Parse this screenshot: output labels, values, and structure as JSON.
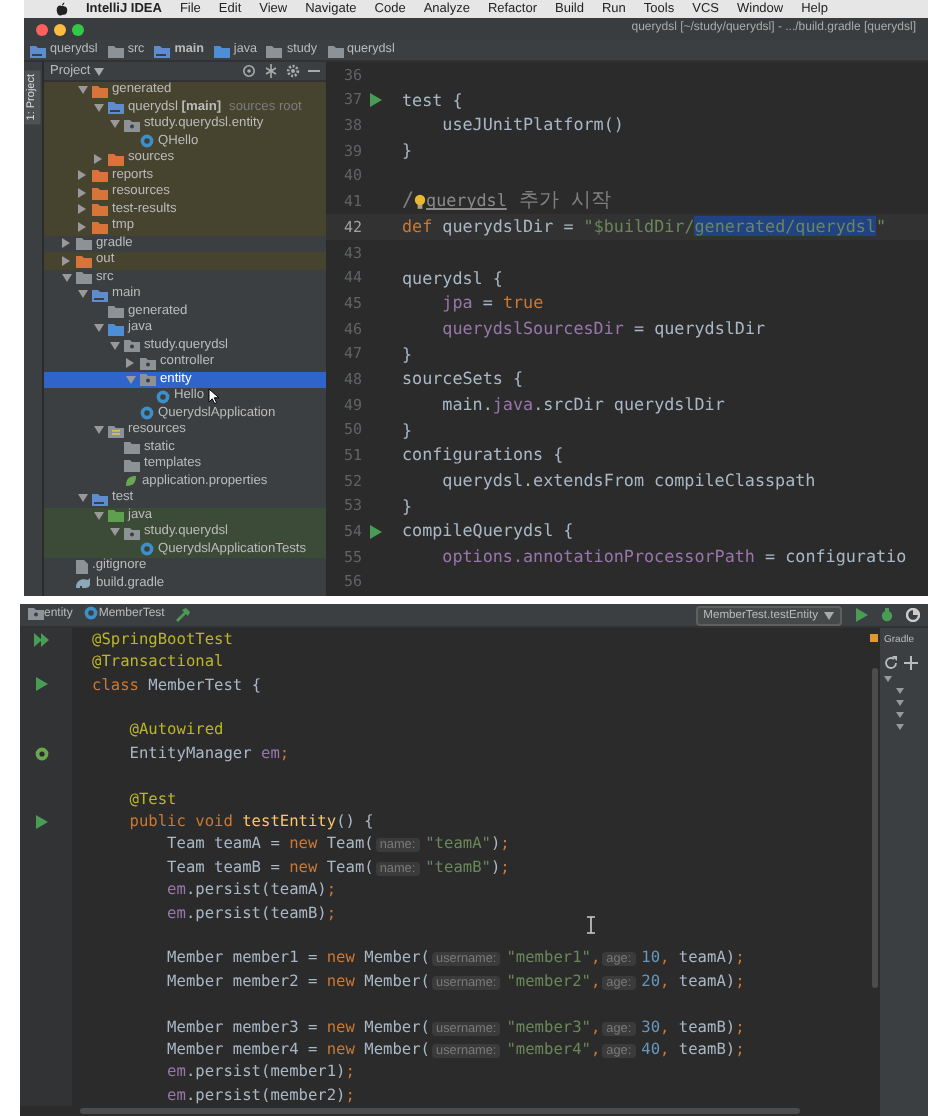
{
  "menubar": {
    "app": "IntelliJ IDEA",
    "items": [
      "File",
      "Edit",
      "View",
      "Navigate",
      "Code",
      "Analyze",
      "Refactor",
      "Build",
      "Run",
      "Tools",
      "VCS",
      "Window",
      "Help"
    ]
  },
  "window": {
    "title": "querydsl [~/study/querydsl] - .../build.gradle [querydsl]"
  },
  "breadcrumb": [
    {
      "label": "querydsl",
      "kind": "module",
      "bold": false
    },
    {
      "label": "src",
      "kind": "folder",
      "bold": false
    },
    {
      "label": "main",
      "kind": "module",
      "bold": true
    },
    {
      "label": "java",
      "kind": "source",
      "bold": false
    },
    {
      "label": "study",
      "kind": "folder",
      "bold": false
    },
    {
      "label": "querydsl",
      "kind": "folder",
      "bold": false
    }
  ],
  "project_panel": {
    "tool_tab": "1: Project",
    "title": "Project",
    "tree": [
      {
        "children": [
          {
            "label": "generated",
            "kind": "excluded",
            "expanded": true,
            "selected": false,
            "color": "#46432f",
            "children": [
              {
                "label": "querydsl **[main]**",
                "hint": "sources root",
                "kind": "module",
                "expanded": true,
                "selected": false,
                "color": "#46432f",
                "children": [
                  {
                    "label": "study.querydsl.entity",
                    "kind": "package",
                    "expanded": true,
                    "selected": false,
                    "color": "#46432f",
                    "children": [
                      {
                        "label": "QHello",
                        "kind": "class",
                        "selected": false,
                        "color": "#46432f"
                      }
                    ]
                  }
                ]
              },
              {
                "label": "sources",
                "kind": "excluded",
                "expanded": false,
                "selected": false,
                "color": "#46432f"
              }
            ]
          },
          {
            "label": "reports",
            "kind": "excluded",
            "expanded": false,
            "selected": false,
            "color": "#46432f"
          },
          {
            "label": "resources",
            "kind": "excluded",
            "expanded": false,
            "selected": false,
            "color": "#46432f"
          },
          {
            "label": "test-results",
            "kind": "excluded",
            "expanded": false,
            "selected": false,
            "color": "#46432f"
          },
          {
            "label": "tmp",
            "kind": "excluded",
            "expanded": false,
            "selected": false,
            "color": "#46432f"
          }
        ]
      },
      {
        "label": "gradle",
        "kind": "folder",
        "expanded": false,
        "selected": false
      },
      {
        "label": "out",
        "kind": "excluded",
        "expanded": false,
        "selected": false,
        "color": "#46432f"
      },
      {
        "label": "src",
        "kind": "folder",
        "expanded": true,
        "selected": false,
        "children": [
          {
            "label": "main",
            "kind": "module",
            "expanded": true,
            "selected": false,
            "children": [
              {
                "label": "generated",
                "kind": "folder",
                "selected": false
              },
              {
                "label": "java",
                "kind": "source",
                "expanded": true,
                "selected": false,
                "children": [
                  {
                    "label": "study.querydsl",
                    "kind": "package",
                    "expanded": true,
                    "selected": false,
                    "children": [
                      {
                        "label": "controller",
                        "kind": "package",
                        "expanded": false,
                        "selected": false
                      },
                      {
                        "label": "entity",
                        "kind": "package",
                        "expanded": true,
                        "selected": true,
                        "children": [
                          {
                            "label": "Hello",
                            "kind": "class",
                            "selected": false
                          }
                        ]
                      },
                      {
                        "label": "QuerydslApplication",
                        "kind": "class",
                        "selected": false
                      }
                    ]
                  }
                ]
              },
              {
                "label": "resources",
                "kind": "resource",
                "expanded": true,
                "selected": false,
                "children": [
                  {
                    "label": "static",
                    "kind": "folder",
                    "selected": false
                  },
                  {
                    "label": "templates",
                    "kind": "folder",
                    "selected": false
                  },
                  {
                    "label": "application.properties",
                    "kind": "properties",
                    "selected": false
                  }
                ]
              }
            ]
          },
          {
            "label": "test",
            "kind": "module",
            "expanded": true,
            "selected": false,
            "children": [
              {
                "label": "java",
                "kind": "test",
                "expanded": true,
                "selected": false,
                "color": "#3c4a38",
                "children": [
                  {
                    "label": "study.querydsl",
                    "kind": "package",
                    "expanded": true,
                    "selected": false,
                    "color": "#3c4a38",
                    "children": [
                      {
                        "label": "QuerydslApplicationTests",
                        "kind": "class",
                        "selected": false,
                        "color": "#3c4a38"
                      }
                    ]
                  }
                ]
              }
            ]
          }
        ]
      },
      {
        "label": ".gitignore",
        "kind": "file",
        "selected": false
      },
      {
        "label": "build.gradle",
        "kind": "gradle",
        "selected": false
      }
    ]
  },
  "editor": {
    "lines": [
      {
        "num": "36"
      },
      {
        "num": "37",
        "kind": "run",
        "tokens": [
          {
            "kind": "pl",
            "text": "test {"
          }
        ]
      },
      {
        "num": "38",
        "tokens": [
          {
            "kind": "pl",
            "text": "    useJUnitPlatform()"
          }
        ]
      },
      {
        "num": "39",
        "tokens": [
          {
            "kind": "pl",
            "text": "}"
          }
        ]
      },
      {
        "num": "40"
      },
      {
        "num": "41",
        "tokens": [
          {
            "kind": "cmt",
            "text": "/"
          },
          {
            "kind": "bulb"
          },
          {
            "kind": "link",
            "text": "querydsl"
          },
          {
            "kind": "cmt",
            "text": " 추가 시작"
          }
        ]
      },
      {
        "num": "42",
        "current": true,
        "tokens": [
          {
            "kind": "kw",
            "text": "def"
          },
          {
            "kind": "pl",
            "text": " querydslDir = "
          },
          {
            "kind": "str",
            "text": "\"$buildDir/"
          },
          {
            "kind": "sel",
            "text": "generated/querydsl"
          },
          {
            "kind": "str",
            "text": "\""
          }
        ]
      },
      {
        "num": "43"
      },
      {
        "num": "44",
        "tokens": [
          {
            "kind": "pl",
            "text": "querydsl {"
          }
        ]
      },
      {
        "num": "45",
        "tokens": [
          {
            "kind": "fld",
            "text": "    jpa"
          },
          {
            "kind": "pl",
            "text": " = "
          },
          {
            "kind": "kw",
            "text": "true"
          }
        ]
      },
      {
        "num": "46",
        "tokens": [
          {
            "kind": "fld",
            "text": "    querydslSourcesDir"
          },
          {
            "kind": "pl",
            "text": " = querydslDir"
          }
        ]
      },
      {
        "num": "47",
        "tokens": [
          {
            "kind": "pl",
            "text": "}"
          }
        ]
      },
      {
        "num": "48",
        "tokens": [
          {
            "kind": "pl",
            "text": "sourceSets {"
          }
        ]
      },
      {
        "num": "49",
        "tokens": [
          {
            "kind": "pl",
            "text": "    main."
          },
          {
            "kind": "fld",
            "text": "java"
          },
          {
            "kind": "pl",
            "text": ".srcDir querydslDir"
          }
        ]
      },
      {
        "num": "50",
        "tokens": [
          {
            "kind": "pl",
            "text": "}"
          }
        ]
      },
      {
        "num": "51",
        "tokens": [
          {
            "kind": "pl",
            "text": "configurations {"
          }
        ]
      },
      {
        "num": "52",
        "tokens": [
          {
            "kind": "pl",
            "text": "    querydsl.extendsFrom compileClasspath"
          }
        ]
      },
      {
        "num": "53",
        "tokens": [
          {
            "kind": "pl",
            "text": "}"
          }
        ]
      },
      {
        "num": "54",
        "kind": "run",
        "tokens": [
          {
            "kind": "pl",
            "text": "compileQuerydsl {"
          }
        ]
      },
      {
        "num": "55",
        "tokens": [
          {
            "kind": "fld",
            "text": "    options.annotationProcessorPath"
          },
          {
            "kind": "pl",
            "text": " = configuratio"
          }
        ]
      },
      {
        "num": "56"
      }
    ]
  },
  "test_editor": {
    "breadcrumb": [
      {
        "label": "entity",
        "kind": "package",
        "bold": false
      },
      {
        "label": "MemberTest",
        "kind": "class",
        "bold": false
      }
    ],
    "run_config": "MemberTest.testEntity",
    "gradle_title": "Gradle",
    "lines": [
      {
        "kind": "run-all",
        "tokens": [
          {
            "kind": "ann",
            "text": "@SpringBootTest"
          }
        ]
      },
      {
        "tokens": [
          {
            "kind": "ann",
            "text": "@Transactional"
          }
        ]
      },
      {
        "kind": "run",
        "tokens": [
          {
            "kind": "kw",
            "text": "class"
          },
          {
            "kind": "pl",
            "text": " MemberTest {"
          }
        ]
      },
      {
        "blank_before": true,
        "tokens": [
          {
            "kind": "ann",
            "text": "    @Autowired"
          }
        ]
      },
      {
        "kind": "bean",
        "tokens": [
          {
            "kind": "pl",
            "text": "    EntityManager "
          },
          {
            "kind": "fld",
            "text": "em"
          },
          {
            "kind": "kw",
            "text": ";"
          }
        ]
      },
      {
        "blank_before": true,
        "tokens": [
          {
            "kind": "ann",
            "text": "    @Test"
          }
        ]
      },
      {
        "kind": "run",
        "tokens": [
          {
            "kind": "kw",
            "text": "    public void"
          },
          {
            "kind": "fn",
            "text": " testEntity"
          },
          {
            "kind": "pl",
            "text": "() {"
          }
        ]
      },
      {
        "tokens": [
          {
            "kind": "pl",
            "text": "        Team teamA = "
          },
          {
            "kind": "kw",
            "text": "new"
          },
          {
            "kind": "pl",
            "text": " Team("
          },
          {
            "kind": "hint",
            "text": "name:"
          },
          {
            "kind": "str",
            "text": "\"teamA\""
          },
          {
            "kind": "pl",
            "text": ")"
          },
          {
            "kind": "kw",
            "text": ";"
          }
        ]
      },
      {
        "tokens": [
          {
            "kind": "pl",
            "text": "        Team teamB = "
          },
          {
            "kind": "kw",
            "text": "new"
          },
          {
            "kind": "pl",
            "text": " Team("
          },
          {
            "kind": "hint",
            "text": "name:"
          },
          {
            "kind": "str",
            "text": "\"teamB\""
          },
          {
            "kind": "pl",
            "text": ")"
          },
          {
            "kind": "kw",
            "text": ";"
          }
        ]
      },
      {
        "tokens": [
          {
            "kind": "fld",
            "text": "        em"
          },
          {
            "kind": "pl",
            "text": ".persist(teamA)"
          },
          {
            "kind": "kw",
            "text": ";"
          }
        ]
      },
      {
        "tokens": [
          {
            "kind": "fld",
            "text": "        em"
          },
          {
            "kind": "pl",
            "text": ".persist(teamB)"
          },
          {
            "kind": "kw",
            "text": ";"
          }
        ]
      },
      {
        "blank_before": true,
        "tokens": [
          {
            "kind": "pl",
            "text": "        Member member1 = "
          },
          {
            "kind": "kw",
            "text": "new"
          },
          {
            "kind": "pl",
            "text": " Member("
          },
          {
            "kind": "hint",
            "text": "username:"
          },
          {
            "kind": "str",
            "text": "\"member1\""
          },
          {
            "kind": "kw",
            "text": ","
          },
          {
            "kind": "hint",
            "text": "age:"
          },
          {
            "kind": "num",
            "text": "10"
          },
          {
            "kind": "kw",
            "text": ","
          },
          {
            "kind": "pl",
            "text": " teamA)"
          },
          {
            "kind": "kw",
            "text": ";"
          }
        ]
      },
      {
        "tokens": [
          {
            "kind": "pl",
            "text": "        Member member2 = "
          },
          {
            "kind": "kw",
            "text": "new"
          },
          {
            "kind": "pl",
            "text": " Member("
          },
          {
            "kind": "hint",
            "text": "username:"
          },
          {
            "kind": "str",
            "text": "\"member2\""
          },
          {
            "kind": "kw",
            "text": ","
          },
          {
            "kind": "hint",
            "text": "age:"
          },
          {
            "kind": "num",
            "text": "20"
          },
          {
            "kind": "kw",
            "text": ","
          },
          {
            "kind": "pl",
            "text": " teamA)"
          },
          {
            "kind": "kw",
            "text": ";"
          }
        ]
      },
      {
        "blank_before": true,
        "tokens": [
          {
            "kind": "pl",
            "text": "        Member member3 = "
          },
          {
            "kind": "kw",
            "text": "new"
          },
          {
            "kind": "pl",
            "text": " Member("
          },
          {
            "kind": "hint",
            "text": "username:"
          },
          {
            "kind": "str",
            "text": "\"member3\""
          },
          {
            "kind": "kw",
            "text": ","
          },
          {
            "kind": "hint",
            "text": "age:"
          },
          {
            "kind": "num",
            "text": "30"
          },
          {
            "kind": "kw",
            "text": ","
          },
          {
            "kind": "pl",
            "text": " teamB)"
          },
          {
            "kind": "kw",
            "text": ";"
          }
        ]
      },
      {
        "tokens": [
          {
            "kind": "pl",
            "text": "        Member member4 = "
          },
          {
            "kind": "kw",
            "text": "new"
          },
          {
            "kind": "pl",
            "text": " Member("
          },
          {
            "kind": "hint",
            "text": "username:"
          },
          {
            "kind": "str",
            "text": "\"member4\""
          },
          {
            "kind": "kw",
            "text": ","
          },
          {
            "kind": "hint",
            "text": "age:"
          },
          {
            "kind": "num",
            "text": "40"
          },
          {
            "kind": "kw",
            "text": ","
          },
          {
            "kind": "pl",
            "text": " teamB)"
          },
          {
            "kind": "kw",
            "text": ";"
          }
        ]
      },
      {
        "tokens": [
          {
            "kind": "fld",
            "text": "        em"
          },
          {
            "kind": "pl",
            "text": ".persist(member1)"
          },
          {
            "kind": "kw",
            "text": ";"
          }
        ]
      },
      {
        "tokens": [
          {
            "kind": "fld",
            "text": "        em"
          },
          {
            "kind": "pl",
            "text": ".persist(member2)"
          },
          {
            "kind": "kw",
            "text": ";"
          }
        ]
      }
    ]
  }
}
